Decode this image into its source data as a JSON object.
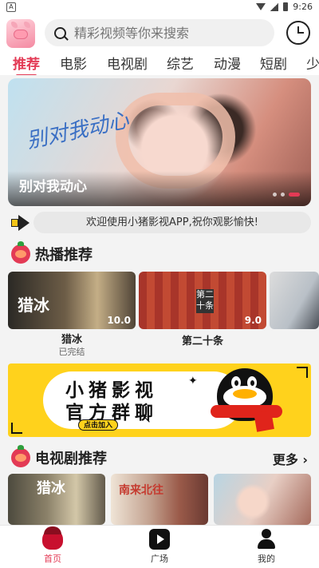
{
  "status_bar": {
    "time": "9:26",
    "notif": "A"
  },
  "header": {
    "search_placeholder": "精彩视频等你来搜索"
  },
  "tabs": [
    {
      "label": "推荐",
      "active": true
    },
    {
      "label": "电影",
      "active": false
    },
    {
      "label": "电视剧",
      "active": false
    },
    {
      "label": "综艺",
      "active": false
    },
    {
      "label": "动漫",
      "active": false
    },
    {
      "label": "短剧",
      "active": false
    },
    {
      "label": "少",
      "active": false
    }
  ],
  "banner": {
    "caption": "别对我动心",
    "art_text": "别对我动心",
    "page_count": 3,
    "active_page": 3
  },
  "notice": {
    "text": "欢迎使用小猪影视APP,祝你观影愉快!"
  },
  "hot": {
    "title": "热播推荐",
    "items": [
      {
        "title": "猎冰",
        "status": "已完结",
        "art": "猎冰",
        "score": "10.0"
      },
      {
        "title": "第二十条",
        "status": "",
        "art": "第二十条",
        "score": "9.0"
      },
      {
        "title": "",
        "status": "",
        "art": "",
        "score": ""
      }
    ]
  },
  "ad": {
    "line1": "小猪影视",
    "line2": "官方群聊",
    "button": "点击加入"
  },
  "tv": {
    "title": "电视剧推荐",
    "more": "更多 ›",
    "items": [
      {
        "art": "猎冰"
      },
      {
        "art": "南来北往"
      },
      {
        "art": ""
      }
    ]
  },
  "bottom_nav": [
    {
      "label": "首页",
      "icon": "acorn-home-icon",
      "active": true
    },
    {
      "label": "广场",
      "icon": "play-tv-icon",
      "active": false
    },
    {
      "label": "我的",
      "icon": "person-icon",
      "active": false
    }
  ],
  "colors": {
    "accent": "#e33a55",
    "ad_yellow": "#ffd21c"
  }
}
